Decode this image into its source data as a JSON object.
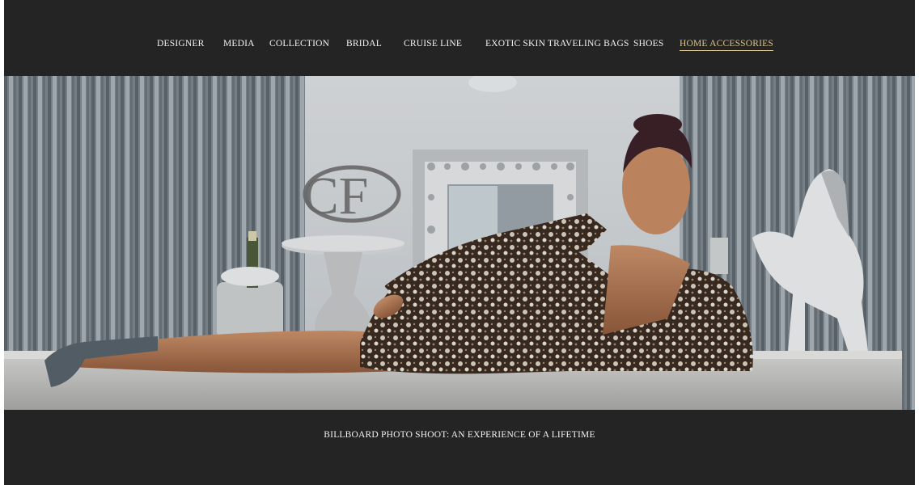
{
  "nav": {
    "items": [
      {
        "label": "DESIGNER",
        "active": false
      },
      {
        "label": "MEDIA",
        "active": false
      },
      {
        "label": "COLLECTION",
        "active": false
      },
      {
        "label": "BRIDAL",
        "active": false
      },
      {
        "label": "CRUISE LINE",
        "active": false
      },
      {
        "label": "EXOTIC SKIN TRAVELING BAGS",
        "active": false
      },
      {
        "label": "SHOES",
        "active": false
      },
      {
        "label": "HOME ACCESSORIES",
        "active": true
      }
    ]
  },
  "hero": {
    "logo_text": "CF"
  },
  "caption": {
    "text": "BILLBOARD PHOTO SHOOT: AN EXPERIENCE OF A LIFETIME"
  },
  "colors": {
    "background": "#242424",
    "nav_text": "#f2f2f2",
    "nav_active": "#d9c48a"
  }
}
